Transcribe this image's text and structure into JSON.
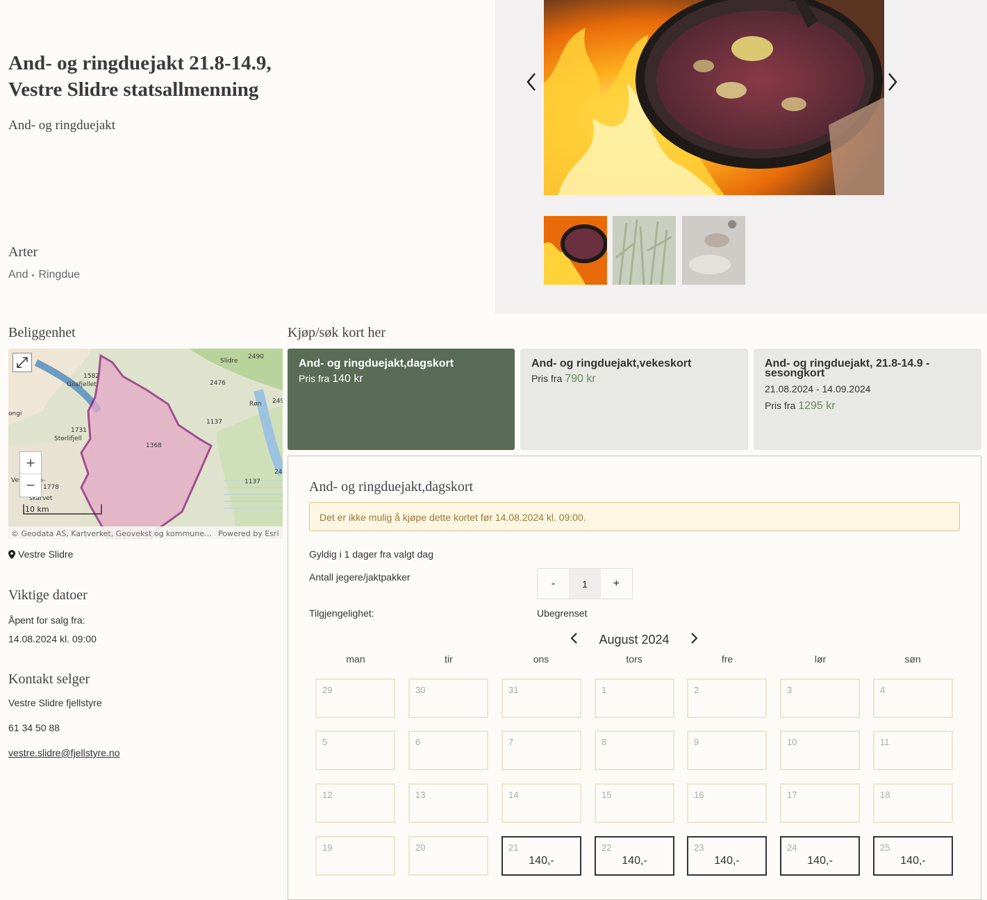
{
  "header": {
    "title_line1": "And- og ringduejakt 21.8-14.9,",
    "title_line2": "Vestre Slidre statsallmenning",
    "subtitle": "And- og ringduejakt"
  },
  "species": {
    "heading": "Arter",
    "items": [
      "And",
      "Ringdue"
    ]
  },
  "location": {
    "heading": "Beliggenhet",
    "name": "Vestre Slidre",
    "map": {
      "labels": [
        "Slidre",
        "2490",
        "Gilafjellet",
        "2476",
        "Røn",
        "249",
        "1582",
        "ongi",
        "1137",
        "Storlifjell",
        "1731",
        "1368",
        "Vestre otn-",
        "1137",
        "1778",
        "skarvet",
        "24"
      ],
      "scale": "10 km",
      "attribution": "© Geodata AS, Kartverket, Geovekst og kommune…",
      "powered": "Powered by Esri",
      "zoom_in": "+",
      "zoom_out": "−"
    }
  },
  "dates": {
    "heading": "Viktige datoer",
    "label": "Åpent for salg fra:",
    "value": "14.08.2024 kl. 09:00"
  },
  "contact": {
    "heading": "Kontakt selger",
    "name": "Vestre Slidre fjellstyre",
    "phone": "61 34 50 88",
    "email": "vestre.slidre@fjellstyre.no"
  },
  "buy": {
    "heading": "Kjøp/søk kort her",
    "cards": [
      {
        "title": "And- og ringduejakt,dagskort",
        "price_prefix": "Pris fra",
        "price": "140 kr"
      },
      {
        "title": "And- og ringduejakt,vekeskort",
        "price_prefix": "Pris fra",
        "price": "790 kr"
      },
      {
        "title": "And- og ringduejakt, 21.8-14.9 - sesongkort",
        "dates": "21.08.2024 - 14.09.2024",
        "price_prefix": "Pris fra",
        "price": "1295 kr"
      }
    ],
    "colors": {
      "selected_bg": "#5a6b56",
      "card_bg": "#e8e8e4",
      "price_green": "#6b8a5e"
    }
  },
  "panel": {
    "title": "And- og ringduejakt,dagskort",
    "notice": "Det er ikke mulig å kjøpe dette kortet før 14.08.2024 kl. 09:00.",
    "validity": "Gyldig i 1 dager fra valgt dag",
    "hunters_label": "Antall jegere/jaktpakker",
    "minus": "-",
    "quantity": "1",
    "plus": "+",
    "availability_label": "Tilgjengelighet:",
    "availability_value": "Ubegrenset"
  },
  "calendar": {
    "month": "August 2024",
    "weekdays": [
      "man",
      "tir",
      "ons",
      "tors",
      "fre",
      "lør",
      "søn"
    ],
    "weeks": [
      [
        {
          "d": "29"
        },
        {
          "d": "30"
        },
        {
          "d": "31"
        },
        {
          "d": "1"
        },
        {
          "d": "2"
        },
        {
          "d": "3"
        },
        {
          "d": "4"
        }
      ],
      [
        {
          "d": "5"
        },
        {
          "d": "6"
        },
        {
          "d": "7"
        },
        {
          "d": "8"
        },
        {
          "d": "9"
        },
        {
          "d": "10"
        },
        {
          "d": "11"
        }
      ],
      [
        {
          "d": "12"
        },
        {
          "d": "13"
        },
        {
          "d": "14"
        },
        {
          "d": "15"
        },
        {
          "d": "16"
        },
        {
          "d": "17"
        },
        {
          "d": "18"
        }
      ],
      [
        {
          "d": "19"
        },
        {
          "d": "20"
        },
        {
          "d": "21",
          "p": "140,-"
        },
        {
          "d": "22",
          "p": "140,-"
        },
        {
          "d": "23",
          "p": "140,-"
        },
        {
          "d": "24",
          "p": "140,-"
        },
        {
          "d": "25",
          "p": "140,-"
        }
      ]
    ]
  }
}
